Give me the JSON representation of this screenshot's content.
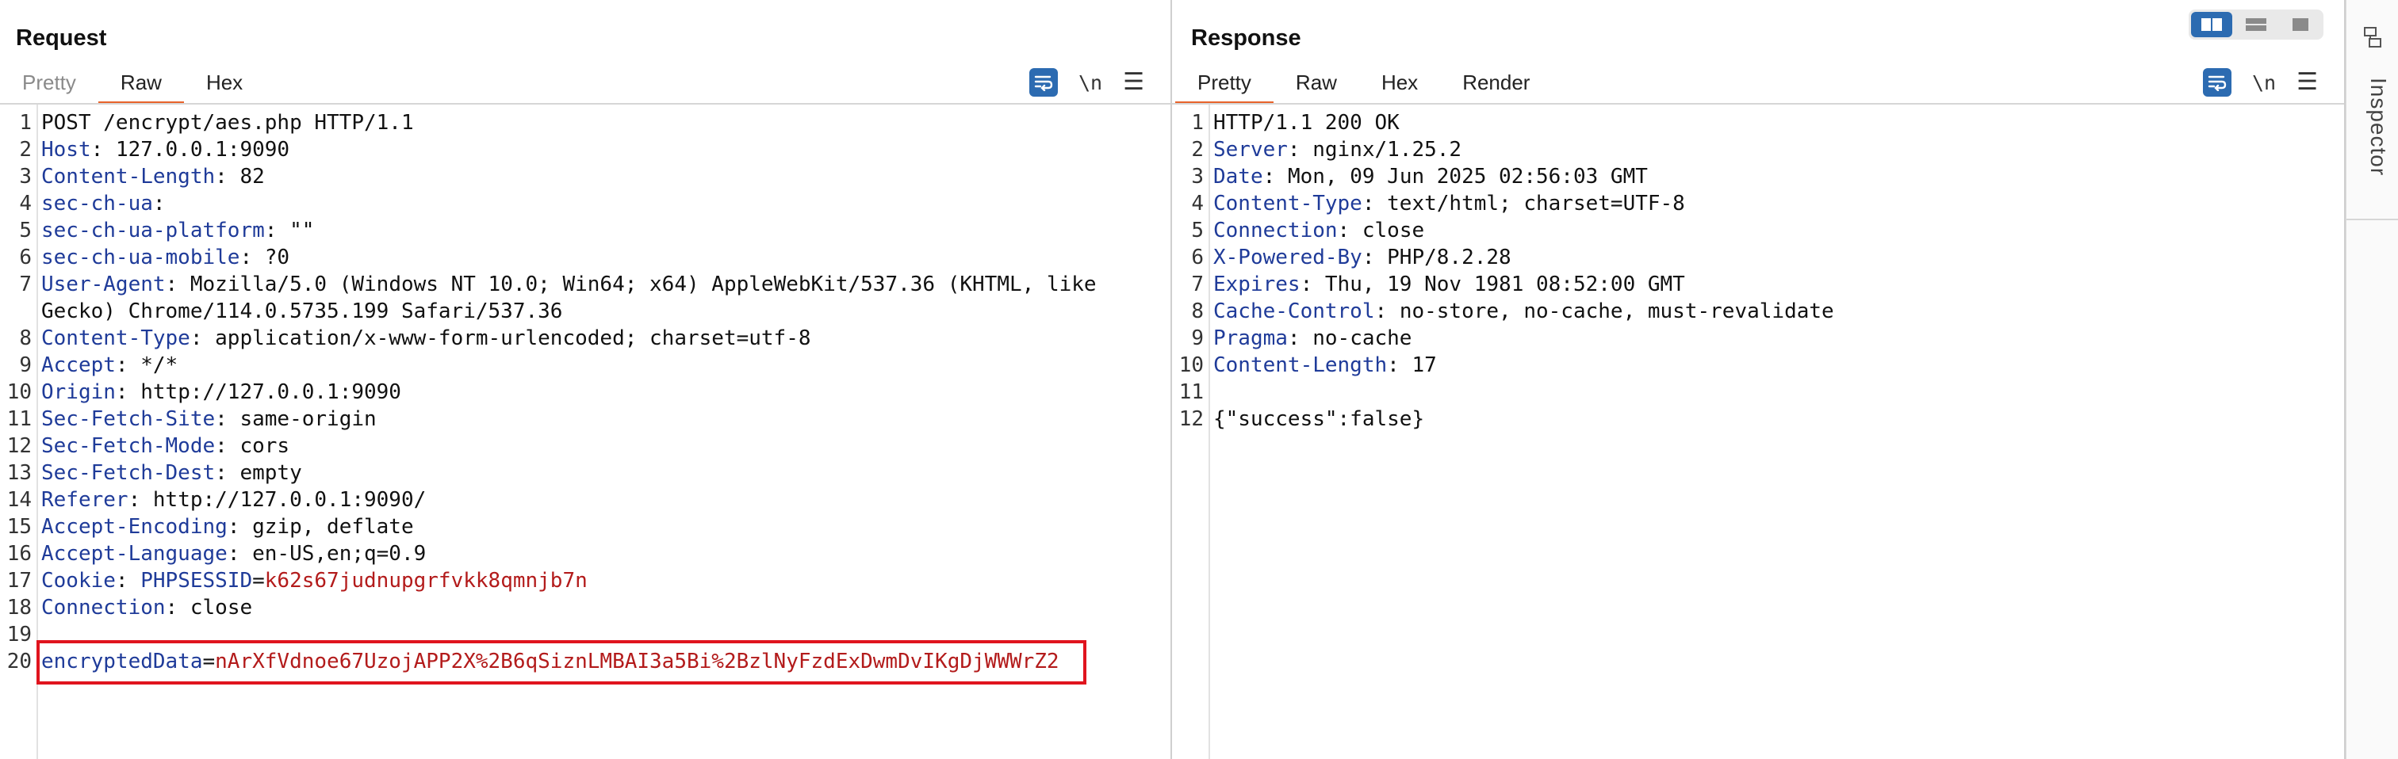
{
  "request": {
    "title": "Request",
    "tabs": [
      "Pretty",
      "Raw",
      "Hex"
    ],
    "active_tab": "Raw",
    "newline_label": "\\n",
    "lines": [
      {
        "n": "1",
        "plain": "POST /encrypt/aes.php HTTP/1.1"
      },
      {
        "n": "2",
        "key": "Host",
        "sep": ": ",
        "value": "127.0.0.1:9090"
      },
      {
        "n": "3",
        "key": "Content-Length",
        "sep": ": ",
        "value": "82"
      },
      {
        "n": "4",
        "key": "sec-ch-ua",
        "sep": ":",
        "value": ""
      },
      {
        "n": "5",
        "key": "sec-ch-ua-platform",
        "sep": ": ",
        "value": "\"\""
      },
      {
        "n": "6",
        "key": "sec-ch-ua-mobile",
        "sep": ": ",
        "value": "?0"
      },
      {
        "n": "7",
        "key": "User-Agent",
        "sep": ": ",
        "value": "Mozilla/5.0 (Windows NT 10.0; Win64; x64) AppleWebKit/537.36 (KHTML, like"
      },
      {
        "n": "",
        "plain": "Gecko) Chrome/114.0.5735.199 Safari/537.36"
      },
      {
        "n": "8",
        "key": "Content-Type",
        "sep": ": ",
        "value": "application/x-www-form-urlencoded; charset=utf-8"
      },
      {
        "n": "9",
        "key": "Accept",
        "sep": ": ",
        "value": "*/*"
      },
      {
        "n": "10",
        "key": "Origin",
        "sep": ": ",
        "value": "http://127.0.0.1:9090"
      },
      {
        "n": "11",
        "key": "Sec-Fetch-Site",
        "sep": ": ",
        "value": "same-origin"
      },
      {
        "n": "12",
        "key": "Sec-Fetch-Mode",
        "sep": ": ",
        "value": "cors"
      },
      {
        "n": "13",
        "key": "Sec-Fetch-Dest",
        "sep": ": ",
        "value": "empty"
      },
      {
        "n": "14",
        "key": "Referer",
        "sep": ": ",
        "value": "http://127.0.0.1:9090/"
      },
      {
        "n": "15",
        "key": "Accept-Encoding",
        "sep": ": ",
        "value": "gzip, deflate"
      },
      {
        "n": "16",
        "key": "Accept-Language",
        "sep": ": ",
        "value": "en-US,en;q=0.9"
      },
      {
        "n": "17",
        "key": "Cookie",
        "sep": ": ",
        "ckey": "PHPSESSID",
        "cval": "k62s67judnupgrfvkk8qmnjb7n"
      },
      {
        "n": "18",
        "key": "Connection",
        "sep": ": ",
        "value": "close"
      },
      {
        "n": "19",
        "plain": ""
      },
      {
        "n": "20",
        "ckey": "encryptedData",
        "cval": "nArXfVdnoe67UzojAPP2X%2B6qSiznLMBAI3a5Bi%2BzlNyFzdExDwmDvIKgDjWWWrZ2"
      }
    ]
  },
  "response": {
    "title": "Response",
    "tabs": [
      "Pretty",
      "Raw",
      "Hex",
      "Render"
    ],
    "active_tab": "Pretty",
    "newline_label": "\\n",
    "lines": [
      {
        "n": "1",
        "plain": "HTTP/1.1 200 OK"
      },
      {
        "n": "2",
        "key": "Server",
        "sep": ": ",
        "value": "nginx/1.25.2"
      },
      {
        "n": "3",
        "key": "Date",
        "sep": ": ",
        "value": "Mon, 09 Jun 2025 02:56:03 GMT"
      },
      {
        "n": "4",
        "key": "Content-Type",
        "sep": ": ",
        "value": "text/html; charset=UTF-8"
      },
      {
        "n": "5",
        "key": "Connection",
        "sep": ": ",
        "value": "close"
      },
      {
        "n": "6",
        "key": "X-Powered-By",
        "sep": ": ",
        "value": "PHP/8.2.28"
      },
      {
        "n": "7",
        "key": "Expires",
        "sep": ": ",
        "value": "Thu, 19 Nov 1981 08:52:00 GMT"
      },
      {
        "n": "8",
        "key": "Cache-Control",
        "sep": ": ",
        "value": "no-store, no-cache, must-revalidate"
      },
      {
        "n": "9",
        "key": "Pragma",
        "sep": ": ",
        "value": "no-cache"
      },
      {
        "n": "10",
        "key": "Content-Length",
        "sep": ": ",
        "value": "17"
      },
      {
        "n": "11",
        "plain": ""
      },
      {
        "n": "12",
        "plain": "{\"success\":false}"
      }
    ]
  },
  "inspector": {
    "label": "Inspector"
  },
  "colors": {
    "accent_tab": "#e8632b",
    "header_key": "#1f3b99",
    "cookie_value": "#b31b1b",
    "highlight": "#e0141e",
    "tool_blue": "#2c6bb1"
  }
}
